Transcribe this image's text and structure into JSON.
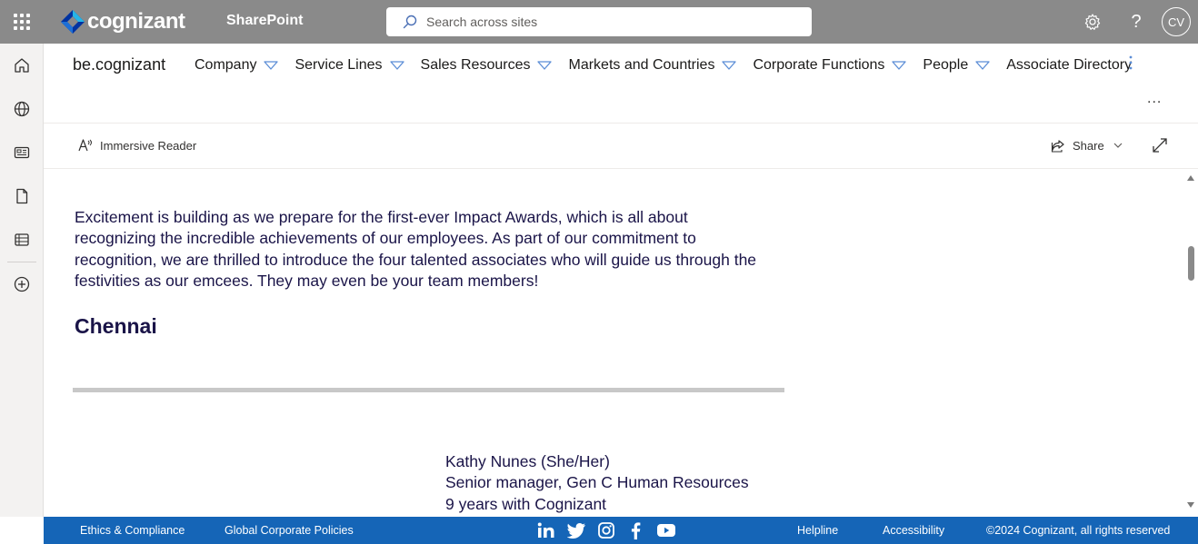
{
  "suite": {
    "brand_name": "cognizant",
    "app_name": "SharePoint",
    "search_placeholder": "Search across sites",
    "avatar_initials": "CV",
    "colors": {
      "bar": "#8a8a8a"
    }
  },
  "hub": {
    "site_name": "be.cognizant",
    "nav": [
      {
        "label": "Company"
      },
      {
        "label": "Service Lines"
      },
      {
        "label": "Sales Resources"
      },
      {
        "label": "Markets and Countries"
      },
      {
        "label": "Corporate Functions"
      },
      {
        "label": "People"
      },
      {
        "label": "Associate Directory"
      }
    ],
    "more_label": "..."
  },
  "commands": {
    "immersive_reader": "Immersive Reader",
    "share": "Share"
  },
  "article": {
    "intro_lines": [
      "Excitement is building as we prepare for the first-ever Impact Awards, which is all about",
      "recognizing the incredible achievements of our employees. As part of our commitment to",
      "recognition, we are thrilled to introduce the four talented associates who will guide us through the",
      "festivities as our emcees. They may even be your team members!"
    ],
    "section_heading": "Chennai",
    "person": {
      "name": "Kathy Nunes (She/Her)",
      "role": "Senior manager, Gen C Human Resources",
      "tenure": "9 years with Cognizant"
    }
  },
  "footer": {
    "links": {
      "ethics": "Ethics & Compliance",
      "policies": "Global Corporate Policies",
      "helpline": "Helpline",
      "accessibility": "Accessibility"
    },
    "social_icons": [
      "linkedin-icon",
      "twitter-icon",
      "instagram-icon",
      "facebook-icon",
      "youtube-icon"
    ],
    "copyright": "©2024 Cognizant, all rights reserved",
    "colors": {
      "background": "#1565b7"
    }
  }
}
